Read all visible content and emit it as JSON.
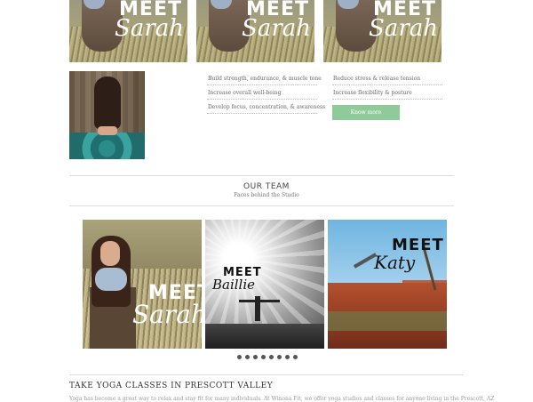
{
  "top_tiles": [
    {
      "meet": "MEET",
      "name": "Sarah"
    },
    {
      "meet": "MEET",
      "name": "Sarah"
    },
    {
      "meet": "MEET",
      "name": "Sarah"
    }
  ],
  "benefits": {
    "col1": [
      "Build strength, endurance, & muscle tone",
      "Increase overall well-being",
      "Develop focus, concentration, & awareness"
    ],
    "col2": [
      "Reduce stress & release tension",
      "Increase flexibility & posture"
    ],
    "know_more": "Know more"
  },
  "team": {
    "title": "OUR TEAM",
    "subtitle": "Faces behind the Studio",
    "cards": [
      {
        "meet": "MEET",
        "name": "Sarah"
      },
      {
        "meet": "MEET",
        "name": "Baillie"
      },
      {
        "meet": "MEET",
        "name": "Katy"
      }
    ],
    "dot_count": 8
  },
  "classes": {
    "title": "TAKE YOGA CLASSES IN PRESCOTT VALLEY",
    "text": "Yoga has become a great way to relax and stay fit for many individuals. At Winona Fit, we offer yoga studios and classes for anyone living in the Prescott, AZ"
  }
}
